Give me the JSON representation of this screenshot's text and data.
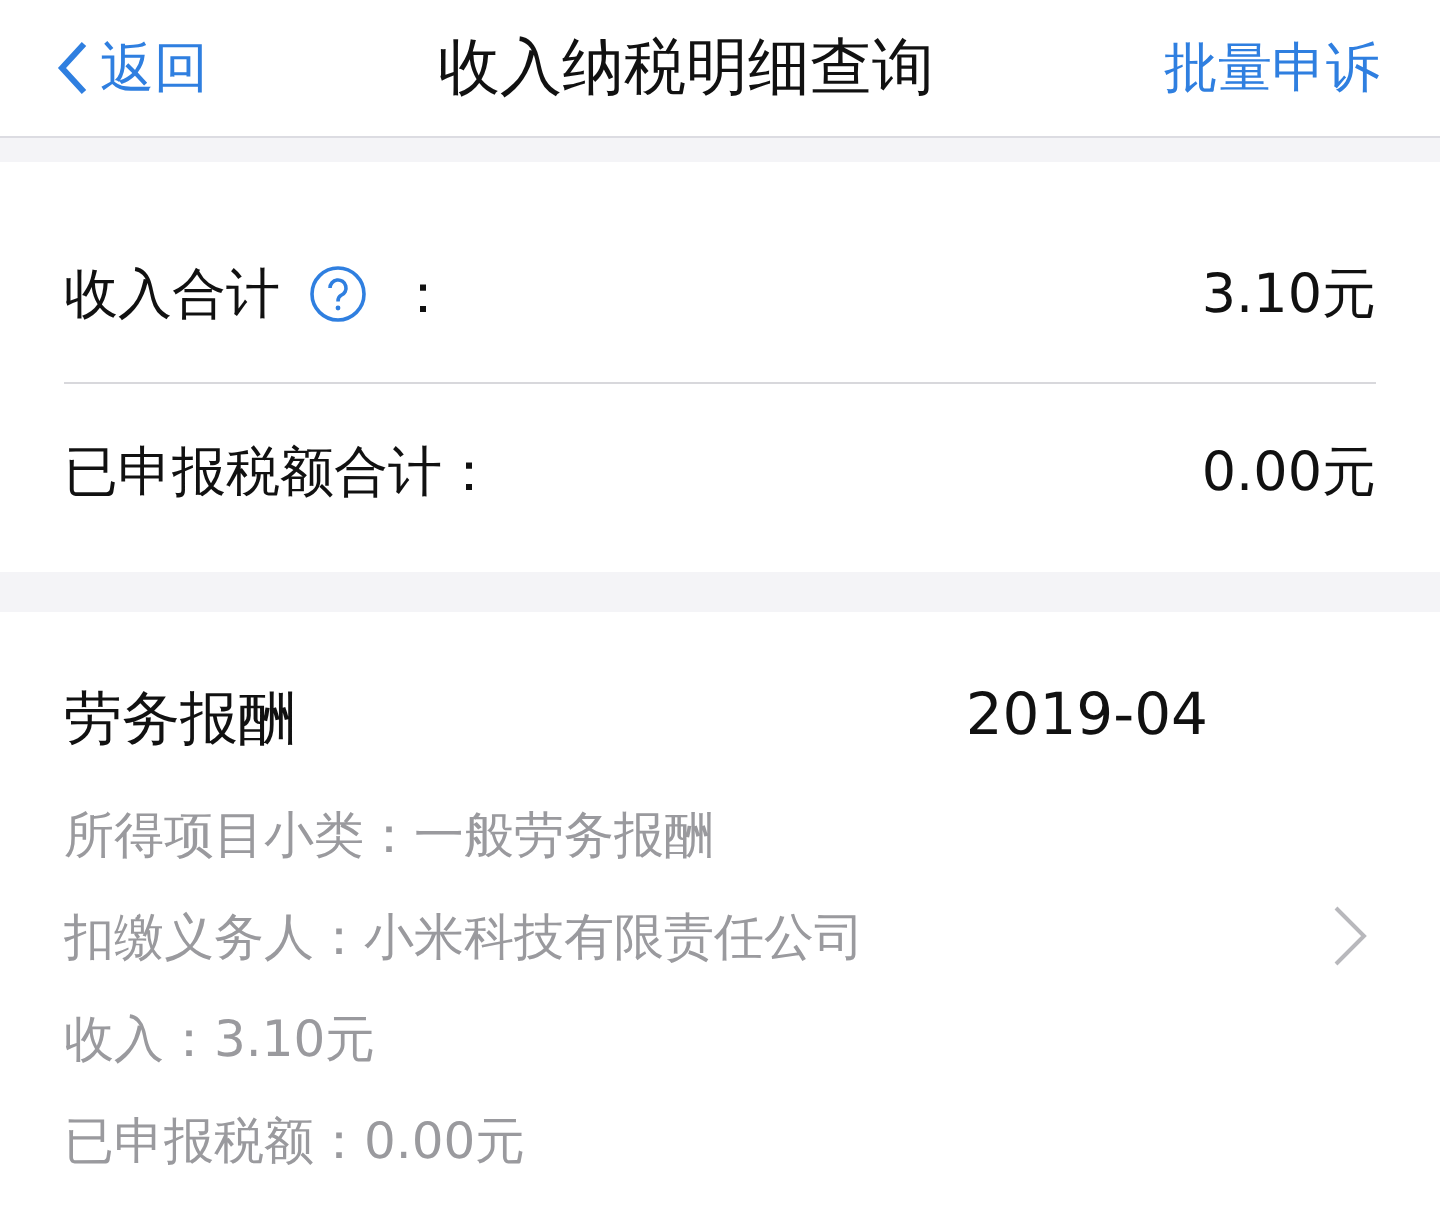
{
  "nav": {
    "back": "返回",
    "title": "收入纳税明细查询",
    "action": "批量申诉"
  },
  "summary": [
    {
      "label": "收入合计",
      "help": true,
      "colon": "：",
      "value": "3.10元"
    },
    {
      "label": "已申报税额合计：",
      "value": "0.00元"
    }
  ],
  "record": {
    "title": "劳务报酬",
    "period": "2019-04",
    "details": [
      "所得项目小类：一般劳务报酬",
      "扣缴义务人：小米科技有限责任公司",
      "收入：3.10元",
      "已申报税额：0.00元"
    ]
  }
}
